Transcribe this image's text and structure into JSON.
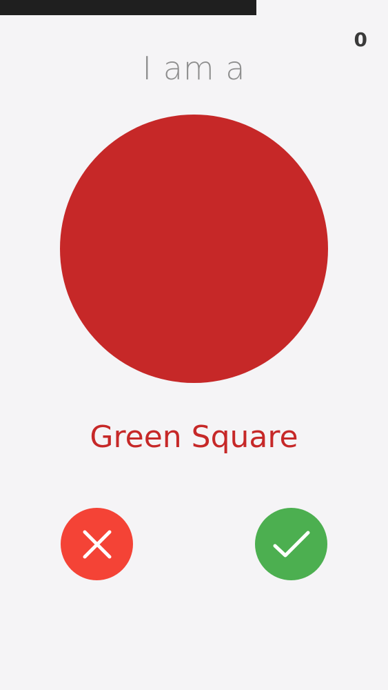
{
  "score": "0",
  "prompt": "I am a",
  "shape": {
    "kind": "circle",
    "color": "#c62828"
  },
  "word": {
    "text": "Green Square",
    "color": "#c62828"
  },
  "buttons": {
    "wrong": {
      "icon": "close-icon",
      "color": "#f44336"
    },
    "right": {
      "icon": "check-icon",
      "color": "#4caf50"
    }
  },
  "colors": {
    "background": "#f5f4f6",
    "status_bar": "#1f1f1f",
    "score": "#3a3a3a",
    "prompt": "#8e8e8e"
  }
}
